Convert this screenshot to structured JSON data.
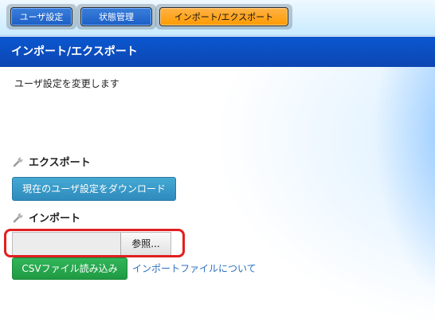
{
  "tabs": [
    {
      "label": "ユーザ設定",
      "active": false
    },
    {
      "label": "状態管理",
      "active": false
    },
    {
      "label": "インポート/エクスポート",
      "active": true
    }
  ],
  "header": {
    "title": "インポート/エクスポート"
  },
  "main": {
    "description": "ユーザ設定を変更します",
    "export": {
      "title": "エクスポート",
      "button_label": "現在のユーザ設定をダウンロード"
    },
    "import": {
      "title": "インポート",
      "file_input_value": "",
      "browse_label": "参照...",
      "submit_label": "CSVファイル読み込み",
      "help_link": "インポートファイルについて"
    }
  },
  "colors": {
    "header_bg": "#0d4fc4",
    "active_tab": "#ff9a00",
    "teal_button": "#3a9cc9",
    "green_button": "#23a34a",
    "highlight": "#e02020",
    "link": "#2a6fc0"
  },
  "icons": {
    "section_icon": "wrench-icon"
  }
}
